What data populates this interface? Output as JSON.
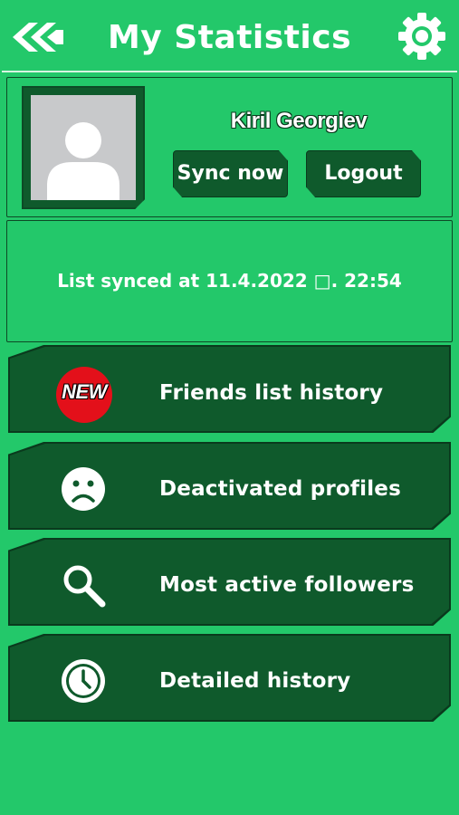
{
  "header": {
    "title": "My Statistics",
    "back_icon": "double-chevron-left-icon",
    "settings_icon": "gear-icon"
  },
  "profile": {
    "name": "Kiril Georgiev",
    "avatar_icon": "user-placeholder-icon",
    "sync_label": "Sync now",
    "logout_label": "Logout"
  },
  "sync_status": {
    "text": "List synced at 11.4.2022 □. 22:54"
  },
  "menu": {
    "items": [
      {
        "label": "Friends list history",
        "icon": "new-badge-icon",
        "badge": "NEW"
      },
      {
        "label": "Deactivated profiles",
        "icon": "sad-face-icon"
      },
      {
        "label": "Most active followers",
        "icon": "magnifier-icon"
      },
      {
        "label": "Detailed history",
        "icon": "clock-icon"
      }
    ]
  },
  "colors": {
    "background": "#23c86a",
    "panel_dark": "#0f5a2c",
    "border_dark": "#0a3a1d",
    "badge_red": "#e3101a",
    "text": "#ffffff"
  }
}
